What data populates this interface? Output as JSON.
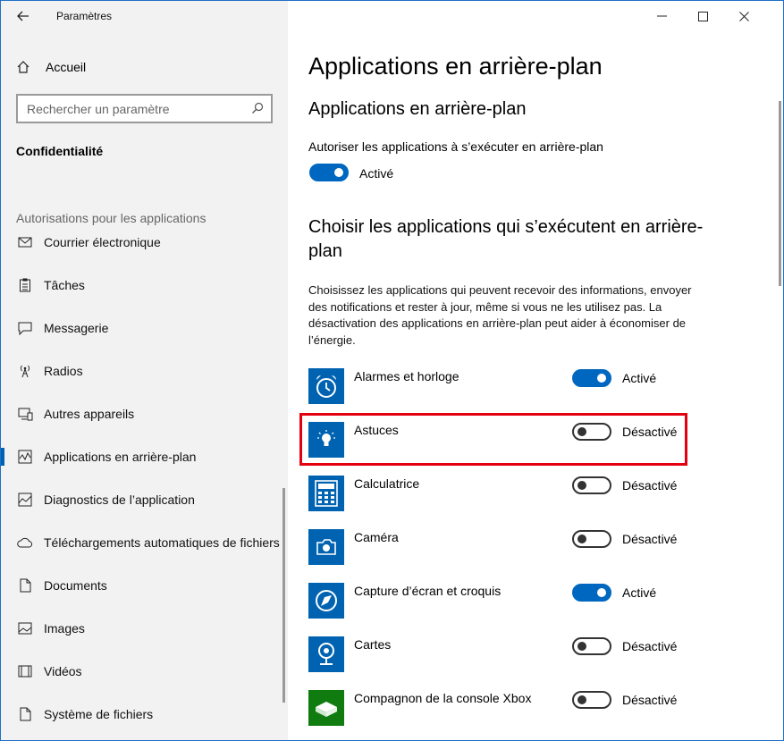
{
  "window": {
    "title": "Paramètres"
  },
  "sidebar": {
    "home_label": "Accueil",
    "search_placeholder": "Rechercher un paramètre",
    "category": "Confidentialité",
    "section_label": "Autorisations pour les applications",
    "items": [
      {
        "label": "Courrier électronique",
        "icon": "mail-icon"
      },
      {
        "label": "Tâches",
        "icon": "tasks-icon"
      },
      {
        "label": "Messagerie",
        "icon": "message-icon"
      },
      {
        "label": "Radios",
        "icon": "radio-icon"
      },
      {
        "label": "Autres appareils",
        "icon": "devices-icon"
      },
      {
        "label": "Applications en arrière-plan",
        "icon": "background-apps-icon",
        "active": true
      },
      {
        "label": "Diagnostics de l’application",
        "icon": "diagnostics-icon"
      },
      {
        "label": "Téléchargements automatiques de fichiers",
        "icon": "cloud-icon"
      },
      {
        "label": "Documents",
        "icon": "document-icon"
      },
      {
        "label": "Images",
        "icon": "image-icon"
      },
      {
        "label": "Vidéos",
        "icon": "video-icon"
      },
      {
        "label": "Système de fichiers",
        "icon": "file-system-icon"
      }
    ]
  },
  "main": {
    "page_title": "Applications en arrière-plan",
    "section_title": "Applications en arrière-plan",
    "allow_label": "Autoriser les applications à s’exécuter en arrière-plan",
    "allow_state": "Activé",
    "choose_title": "Choisir les applications qui s’exécutent en arrière-plan",
    "description": "Choisissez les applications qui peuvent recevoir des informations, envoyer des notifications et rester à jour, même si vous ne les utilisez pas. La désactivation des applications en arrière-plan peut aider à économiser de l’énergie.",
    "apps": [
      {
        "name": "Alarmes et horloge",
        "state": "Activé",
        "on": true,
        "icon": "alarm-clock-icon"
      },
      {
        "name": "Astuces",
        "state": "Désactivé",
        "on": false,
        "icon": "lightbulb-icon"
      },
      {
        "name": "Calculatrice",
        "state": "Désactivé",
        "on": false,
        "icon": "calculator-icon"
      },
      {
        "name": "Caméra",
        "state": "Désactivé",
        "on": false,
        "icon": "camera-icon"
      },
      {
        "name": "Capture d’écran et croquis",
        "state": "Activé",
        "on": true,
        "icon": "snip-sketch-icon"
      },
      {
        "name": "Cartes",
        "state": "Désactivé",
        "on": false,
        "icon": "maps-icon"
      },
      {
        "name": "Compagnon de la console Xbox",
        "state": "Désactivé",
        "on": false,
        "icon": "xbox-icon"
      }
    ]
  },
  "colors": {
    "accent": "#0067c0",
    "highlight": "#e3000f",
    "sidebar_bg": "#f2f2f2"
  }
}
